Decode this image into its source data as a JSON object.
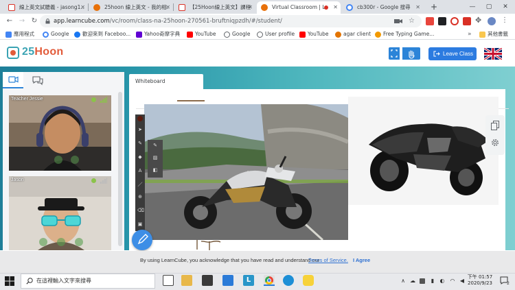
{
  "browser": {
    "tabs": [
      {
        "title": "線上英文試聽義 - jasong1...",
        "icon": "gmail-icon",
        "color": "#d93025",
        "active": false
      },
      {
        "title": "25hoon 線上英文 - 我的相...",
        "icon": "globe-icon",
        "color": "#e8710a",
        "active": false
      },
      {
        "title": "【25Hoon線上英文】課程...",
        "icon": "gmail-icon",
        "color": "#d93025",
        "active": false
      },
      {
        "title": "Virtual Classroom | Le...",
        "icon": "learncube-icon",
        "color": "#e8710a",
        "active": true
      },
      {
        "title": "cb300r - Google 搜尋",
        "icon": "google-icon",
        "color": "#4285f4",
        "active": false
      }
    ],
    "new_tab": "+",
    "window_controls": {
      "minimize": "—",
      "maximize": "▢",
      "close": "✕"
    },
    "url_host": "app.learncube.com",
    "url_path": "/vc/room/class-na-25hoon-270561-bruftniqpzdh/#/student/",
    "bookmarks": [
      {
        "label": "應用程式",
        "icon": "apps-icon",
        "color": "#4285f4"
      },
      {
        "label": "Google",
        "icon": "google-icon",
        "color": "#4285f4"
      },
      {
        "label": "歡迎來到 Faceboo...",
        "icon": "facebook-icon",
        "color": "#1877f2"
      },
      {
        "label": "Yahoo奇摩字典",
        "icon": "yahoo-icon",
        "color": "#6001d2"
      },
      {
        "label": "YouTube",
        "icon": "youtube-icon",
        "color": "#ff0000"
      },
      {
        "label": "Google",
        "icon": "globe-icon",
        "color": "#5f6368"
      },
      {
        "label": "User profile",
        "icon": "user-icon",
        "color": "#5f6368"
      },
      {
        "label": "YouTube",
        "icon": "youtube-icon",
        "color": "#ff0000"
      },
      {
        "label": "agar client",
        "icon": "agar-icon",
        "color": "#e37400"
      },
      {
        "label": "Free Typing Game...",
        "icon": "typing-icon",
        "color": "#f29900"
      }
    ],
    "bookmarks_more": "»",
    "other_bookmarks": "其他書籤"
  },
  "app": {
    "logo_number": "25",
    "logo_word": "Hoon",
    "leave_label": "Leave Class",
    "accent": "#2c7be0",
    "brand_teal": "#3aa3b3",
    "brand_orange": "#e25b3a"
  },
  "sidebar": {
    "participants": [
      {
        "name": "Teacher Jessie",
        "status_color": "#8bc34a"
      },
      {
        "name": "Jason",
        "status_color": "#8bc34a"
      }
    ]
  },
  "whiteboard": {
    "tab_label": "Whiteboard"
  },
  "consent": {
    "text": "By using LearnCube, you acknowledge that you have read and understand our",
    "link": "Terms of Service.",
    "agree": "I Agree"
  },
  "taskbar": {
    "search_placeholder": "在這裡輸入文字來搜尋",
    "time": "下午 01:57",
    "date": "2020/9/23",
    "notification_count": "2"
  }
}
